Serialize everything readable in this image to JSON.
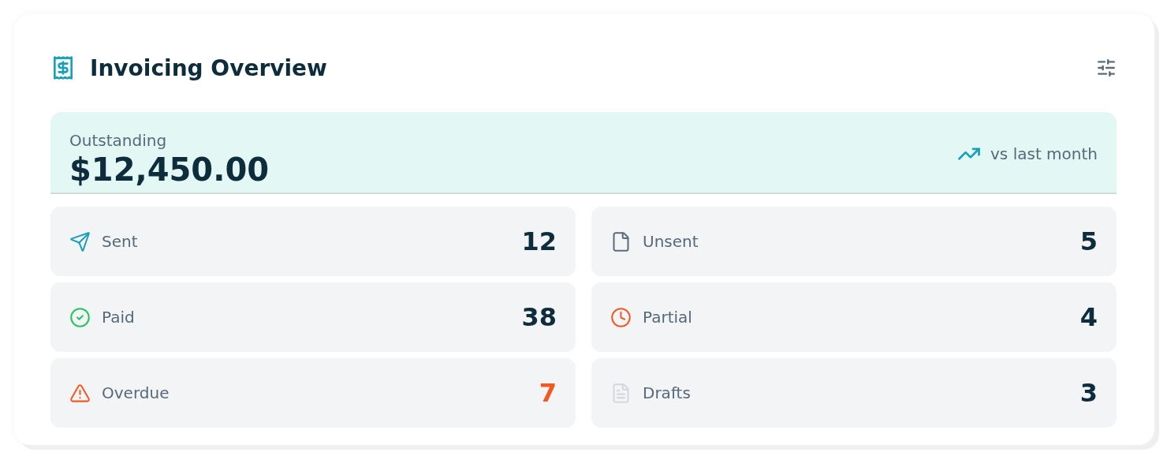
{
  "header": {
    "title": "Invoicing Overview"
  },
  "summary": {
    "label": "Outstanding",
    "amount": "$12,450.00",
    "trend": "vs last month"
  },
  "stats": [
    {
      "kind": "sent",
      "label": "Sent",
      "value": "12",
      "alert": false
    },
    {
      "kind": "unsent",
      "label": "Unsent",
      "value": "5",
      "alert": false
    },
    {
      "kind": "paid",
      "label": "Paid",
      "value": "38",
      "alert": false
    },
    {
      "kind": "partial",
      "label": "Partial",
      "value": "4",
      "alert": false
    },
    {
      "kind": "overdue",
      "label": "Overdue",
      "value": "7",
      "alert": true
    },
    {
      "kind": "drafts",
      "label": "Drafts",
      "value": "3",
      "alert": false
    }
  ]
}
